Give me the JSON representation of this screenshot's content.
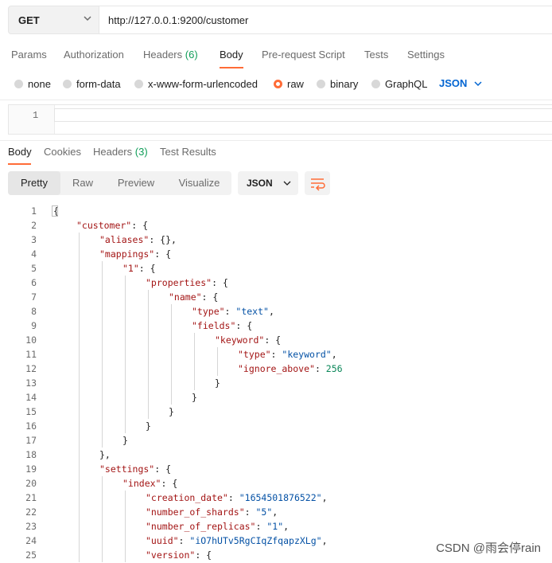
{
  "request": {
    "method": "GET",
    "url": "http://127.0.0.1:9200/customer"
  },
  "request_tabs": [
    {
      "label": "Params"
    },
    {
      "label": "Authorization"
    },
    {
      "label": "Headers",
      "count": "(6)"
    },
    {
      "label": "Body"
    },
    {
      "label": "Pre-request Script"
    },
    {
      "label": "Tests"
    },
    {
      "label": "Settings"
    }
  ],
  "body_types": [
    {
      "label": "none"
    },
    {
      "label": "form-data"
    },
    {
      "label": "x-www-form-urlencoded"
    },
    {
      "label": "raw"
    },
    {
      "label": "binary"
    },
    {
      "label": "GraphQL"
    }
  ],
  "raw_format": "JSON",
  "editor": {
    "line_no": "1"
  },
  "response_tabs": [
    {
      "label": "Body"
    },
    {
      "label": "Cookies"
    },
    {
      "label": "Headers",
      "count": "(3)"
    },
    {
      "label": "Test Results"
    }
  ],
  "view_modes": [
    {
      "label": "Pretty"
    },
    {
      "label": "Raw"
    },
    {
      "label": "Preview"
    },
    {
      "label": "Visualize"
    }
  ],
  "response_format": "JSON",
  "accent_color": "#ff6c37",
  "watermark": "CSDN @雨会停rain",
  "response_lines": [
    {
      "n": "1",
      "i": 0,
      "t": [
        [
          "p",
          "{"
        ]
      ]
    },
    {
      "n": "2",
      "i": 1,
      "t": [
        [
          "k",
          "\"customer\""
        ],
        [
          "p",
          ": {"
        ]
      ]
    },
    {
      "n": "3",
      "i": 2,
      "t": [
        [
          "k",
          "\"aliases\""
        ],
        [
          "p",
          ": {},"
        ]
      ]
    },
    {
      "n": "4",
      "i": 2,
      "t": [
        [
          "k",
          "\"mappings\""
        ],
        [
          "p",
          ": {"
        ]
      ]
    },
    {
      "n": "5",
      "i": 3,
      "t": [
        [
          "k",
          "\"1\""
        ],
        [
          "p",
          ": {"
        ]
      ]
    },
    {
      "n": "6",
      "i": 4,
      "t": [
        [
          "k",
          "\"properties\""
        ],
        [
          "p",
          ": {"
        ]
      ]
    },
    {
      "n": "7",
      "i": 5,
      "t": [
        [
          "k",
          "\"name\""
        ],
        [
          "p",
          ": {"
        ]
      ]
    },
    {
      "n": "8",
      "i": 6,
      "t": [
        [
          "k",
          "\"type\""
        ],
        [
          "p",
          ": "
        ],
        [
          "s",
          "\"text\""
        ],
        [
          "p",
          ","
        ]
      ]
    },
    {
      "n": "9",
      "i": 6,
      "t": [
        [
          "k",
          "\"fields\""
        ],
        [
          "p",
          ": {"
        ]
      ]
    },
    {
      "n": "10",
      "i": 7,
      "t": [
        [
          "k",
          "\"keyword\""
        ],
        [
          "p",
          ": {"
        ]
      ]
    },
    {
      "n": "11",
      "i": 8,
      "t": [
        [
          "k",
          "\"type\""
        ],
        [
          "p",
          ": "
        ],
        [
          "s",
          "\"keyword\""
        ],
        [
          "p",
          ","
        ]
      ]
    },
    {
      "n": "12",
      "i": 8,
      "t": [
        [
          "k",
          "\"ignore_above\""
        ],
        [
          "p",
          ": "
        ],
        [
          "n",
          "256"
        ]
      ]
    },
    {
      "n": "13",
      "i": 7,
      "t": [
        [
          "p",
          "}"
        ]
      ]
    },
    {
      "n": "14",
      "i": 6,
      "t": [
        [
          "p",
          "}"
        ]
      ]
    },
    {
      "n": "15",
      "i": 5,
      "t": [
        [
          "p",
          "}"
        ]
      ]
    },
    {
      "n": "16",
      "i": 4,
      "t": [
        [
          "p",
          "}"
        ]
      ]
    },
    {
      "n": "17",
      "i": 3,
      "t": [
        [
          "p",
          "}"
        ]
      ]
    },
    {
      "n": "18",
      "i": 2,
      "t": [
        [
          "p",
          "},"
        ]
      ]
    },
    {
      "n": "19",
      "i": 2,
      "t": [
        [
          "k",
          "\"settings\""
        ],
        [
          "p",
          ": {"
        ]
      ]
    },
    {
      "n": "20",
      "i": 3,
      "t": [
        [
          "k",
          "\"index\""
        ],
        [
          "p",
          ": {"
        ]
      ]
    },
    {
      "n": "21",
      "i": 4,
      "t": [
        [
          "k",
          "\"creation_date\""
        ],
        [
          "p",
          ": "
        ],
        [
          "s",
          "\"1654501876522\""
        ],
        [
          "p",
          ","
        ]
      ]
    },
    {
      "n": "22",
      "i": 4,
      "t": [
        [
          "k",
          "\"number_of_shards\""
        ],
        [
          "p",
          ": "
        ],
        [
          "s",
          "\"5\""
        ],
        [
          "p",
          ","
        ]
      ]
    },
    {
      "n": "23",
      "i": 4,
      "t": [
        [
          "k",
          "\"number_of_replicas\""
        ],
        [
          "p",
          ": "
        ],
        [
          "s",
          "\"1\""
        ],
        [
          "p",
          ","
        ]
      ]
    },
    {
      "n": "24",
      "i": 4,
      "t": [
        [
          "k",
          "\"uuid\""
        ],
        [
          "p",
          ": "
        ],
        [
          "s",
          "\"iO7hUTv5RgCIqZfqapzXLg\""
        ],
        [
          "p",
          ","
        ]
      ]
    },
    {
      "n": "25",
      "i": 4,
      "t": [
        [
          "k",
          "\"version\""
        ],
        [
          "p",
          ": {"
        ]
      ]
    }
  ]
}
